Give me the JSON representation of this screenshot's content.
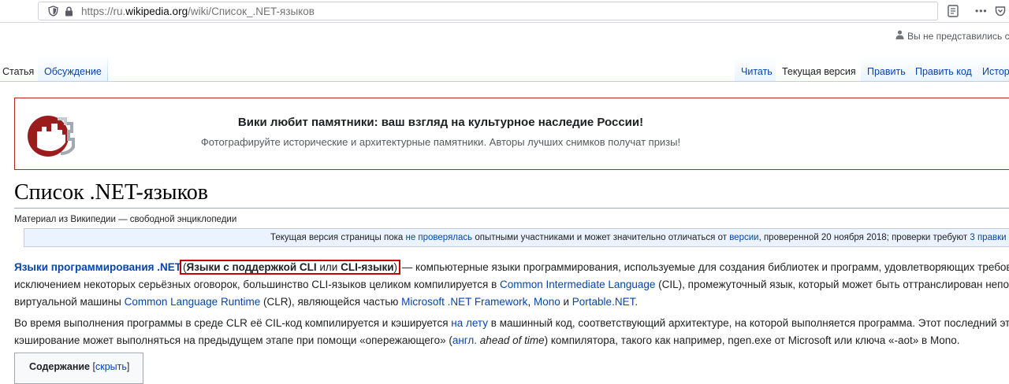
{
  "browser": {
    "url_prefix": "https://ru.",
    "url_host": "wikipedia.org",
    "url_path": "/wiki/Список_.NET-языков",
    "menu_glyph": "•••"
  },
  "personal": {
    "not_logged_in": "Вы не представились си"
  },
  "tabs": {
    "article": "Статья",
    "talk": "Обсуждение",
    "read": "Читать",
    "current": "Текущая версия",
    "edit": "Править",
    "edit_source": "Править код",
    "history": "Истор"
  },
  "banner": {
    "title": "Вики любит памятники: ваш взгляд на культурное наследие России!",
    "subtitle": "Фотографируйте исторические и архитектурные памятники. Авторы лучших снимков получат призы!"
  },
  "article": {
    "title": "Список .NET-языков",
    "site_sub": "Материал из Википедии — свободной энциклопедии",
    "notice": {
      "t1": "Текущая версия страницы пока ",
      "l1": "не проверялась",
      "t2": " опытными участниками и может значительно отличаться от ",
      "l2": "версии",
      "t3": ", проверенной 20 ноября 2018; проверки требуют ",
      "l3": "3 правки"
    },
    "p1": {
      "lead_link": "Языки программирования .NET",
      "open_paren": "(",
      "bold1": "Языки с поддержкой CLI",
      "or": " или ",
      "bold2": "CLI-языки",
      "close_paren": ")",
      "rest_line1": " — компьютерные языки программирования, используемые для создания библиотек и программ, удовлетворяющих требов",
      "line2_a": "исключением некоторых серьёзных оговорок, большинство CLI-языков целиком компилируется в ",
      "line2_link": "Common Intermediate Language",
      "line2_b": " (CIL), промежуточный язык, который может быть оттранслирован непос",
      "line3_a": "виртуальной машины ",
      "line3_link1": "Common Language Runtime",
      "line3_b": " (CLR), являющейся частью ",
      "line3_link2": "Microsoft .NET Framework",
      "line3_c": ", ",
      "line3_link3": "Mono",
      "line3_d": " и ",
      "line3_link4": "Portable.NET",
      "line3_e": "."
    },
    "p2": {
      "line1_a": "Во время выполнения программы в среде CLR её CIL-код компилируется и кэшируется ",
      "line1_link": "на лету",
      "line1_b": " в машинный код, соответствующий архитектуре, на которой выполняется программа. Этот последний эт",
      "line2_a": "кэширование может выполняться на предыдущем этапе при помощи «опережающего» (",
      "line2_link": "англ.",
      "line2_italic": " ahead of time",
      "line2_b": ") компилятора, такого как например, ngen.exe от Microsoft или ключа «-aot» в Mono."
    }
  },
  "toc": {
    "title": "Содержание",
    "toggle_open": "[",
    "toggle_link": "скрыть",
    "toggle_close": "]"
  }
}
